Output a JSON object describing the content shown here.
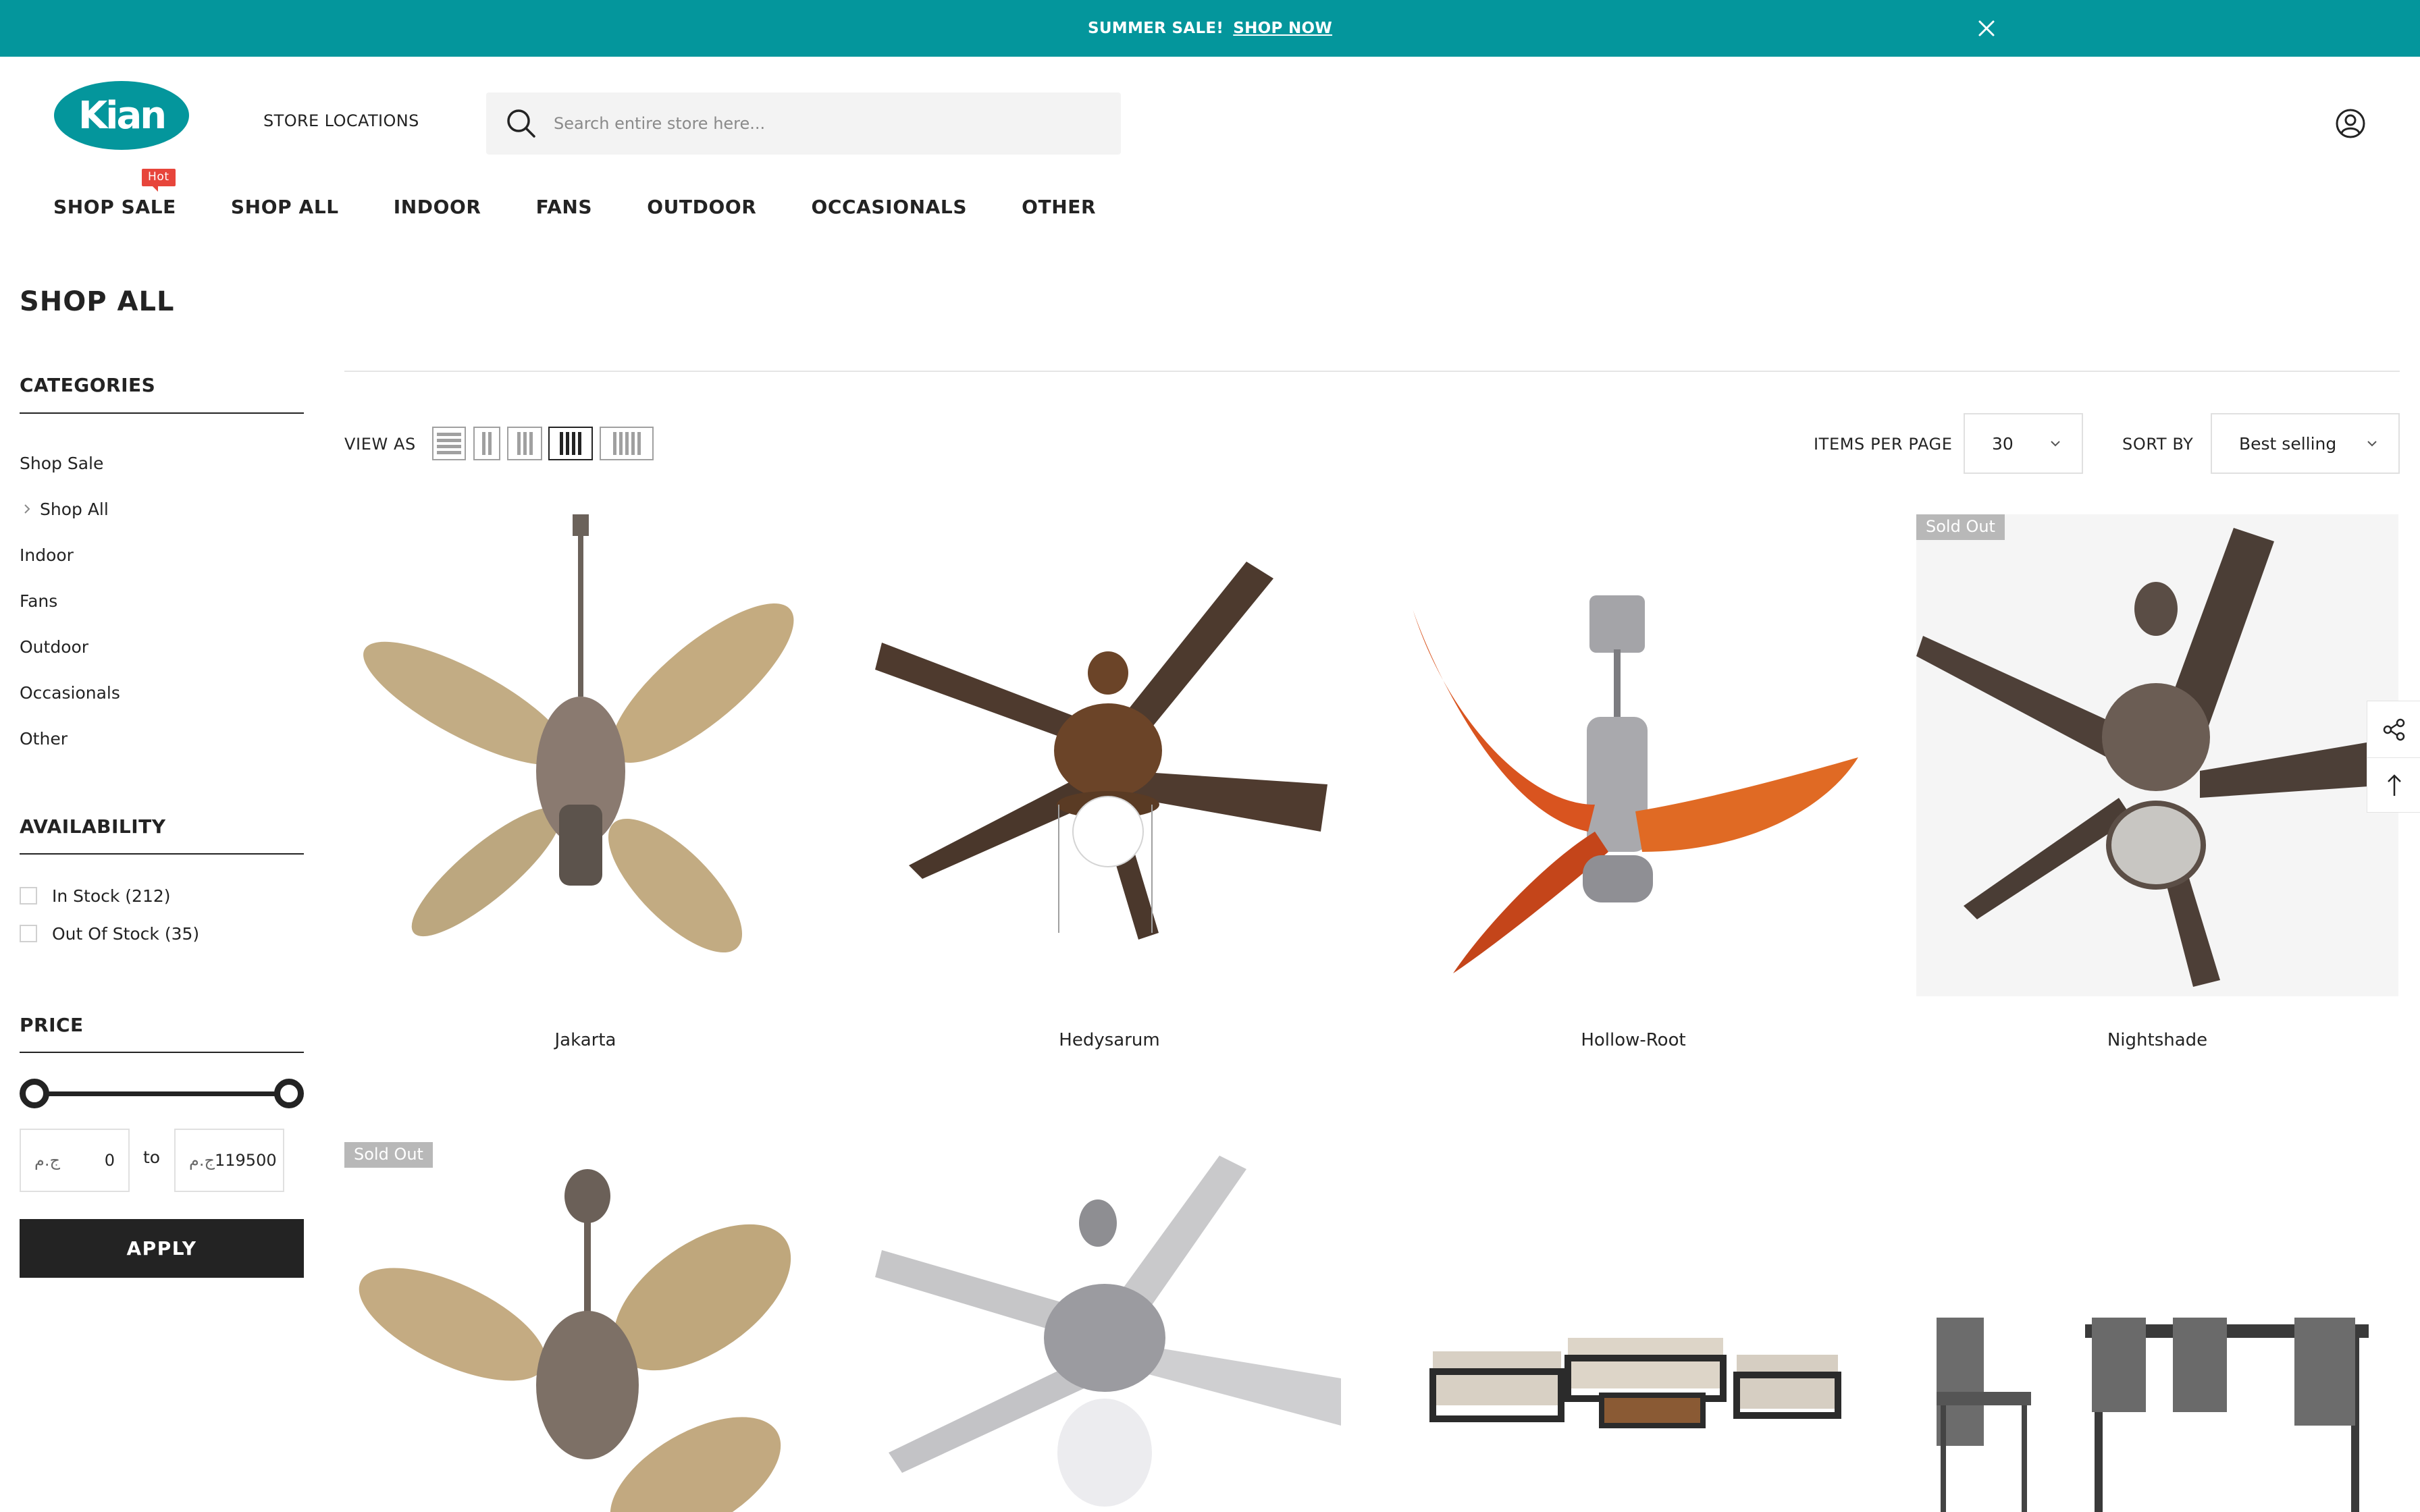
{
  "announcement": {
    "text": "SUMMER SALE!",
    "link": "SHOP NOW"
  },
  "header": {
    "logo_text": "Kian",
    "store_locations": "STORE LOCATIONS",
    "search_placeholder": "Search entire store here..."
  },
  "nav": {
    "items": [
      "SHOP SALE",
      "SHOP ALL",
      "INDOOR",
      "FANS",
      "OUTDOOR",
      "OCCASIONALS",
      "OTHER"
    ],
    "hot_badge": "Hot"
  },
  "page_title": "SHOP ALL",
  "sidebar": {
    "categories_title": "CATEGORIES",
    "categories": [
      "Shop Sale",
      "Shop All",
      "Indoor",
      "Fans",
      "Outdoor",
      "Occasionals",
      "Other"
    ],
    "availability_title": "AVAILABILITY",
    "availability": [
      "In Stock (212)",
      "Out Of Stock (35)"
    ],
    "price_title": "PRICE",
    "price_currency": "ج.م",
    "price_min": "0",
    "price_max": "119500",
    "price_to": "to",
    "apply_label": "APPLY"
  },
  "toolbar": {
    "view_as": "VIEW AS",
    "items_per_page_label": "ITEMS PER PAGE",
    "items_per_page": "30",
    "sort_by_label": "SORT BY",
    "sort_by": "Best selling"
  },
  "products": [
    {
      "name": "Jakarta",
      "badge": ""
    },
    {
      "name": "Hedysarum",
      "badge": ""
    },
    {
      "name": "Hollow-Root",
      "badge": ""
    },
    {
      "name": "Nightshade",
      "badge": "Sold Out"
    },
    {
      "name": "",
      "badge": "Sold Out"
    },
    {
      "name": "",
      "badge": ""
    },
    {
      "name": "",
      "badge": ""
    },
    {
      "name": "",
      "badge": ""
    }
  ],
  "colors": {
    "brand_teal": "#04969c",
    "hot_red": "#e7453b",
    "dark": "#232323"
  }
}
